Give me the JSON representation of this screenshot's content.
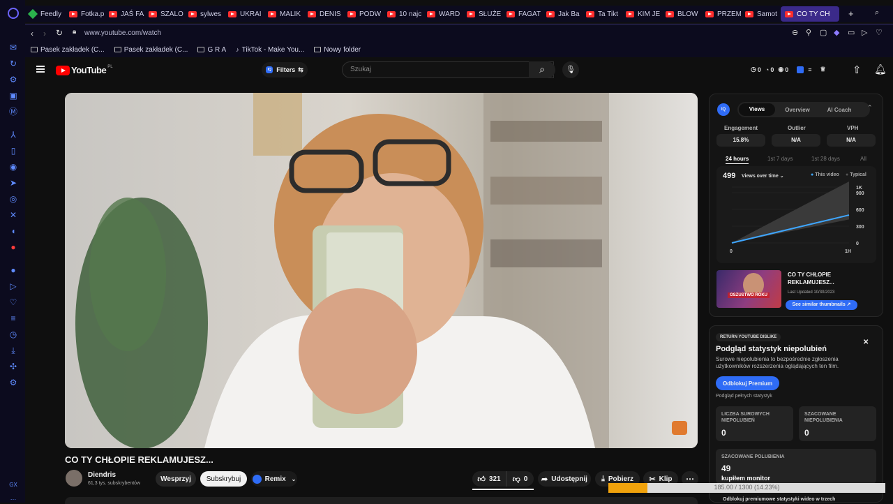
{
  "tabs": [
    {
      "label": "Feedly",
      "icon": "feedly-icon"
    },
    {
      "label": "Fotka.p",
      "icon": "youtube-icon"
    },
    {
      "label": "JAŚ FA",
      "icon": "youtube-icon"
    },
    {
      "label": "SZALO",
      "icon": "youtube-icon"
    },
    {
      "label": "sylwes",
      "icon": "youtube-icon"
    },
    {
      "label": "UKRAI",
      "icon": "youtube-icon"
    },
    {
      "label": "MALIK",
      "icon": "youtube-icon"
    },
    {
      "label": "DENIS",
      "icon": "youtube-icon"
    },
    {
      "label": "PODW",
      "icon": "youtube-icon"
    },
    {
      "label": "10 najc",
      "icon": "youtube-icon"
    },
    {
      "label": "WARD",
      "icon": "youtube-icon"
    },
    {
      "label": "SŁUŻE",
      "icon": "youtube-icon"
    },
    {
      "label": "FAGAT",
      "icon": "youtube-icon"
    },
    {
      "label": "Jak Ba",
      "icon": "youtube-icon"
    },
    {
      "label": "Ta Tikt",
      "icon": "youtube-icon"
    },
    {
      "label": "KIM JE",
      "icon": "youtube-icon"
    },
    {
      "label": "BLOW",
      "icon": "youtube-icon"
    },
    {
      "label": "PRZEM",
      "icon": "youtube-icon"
    },
    {
      "label": "Samot",
      "icon": "youtube-icon"
    },
    {
      "label": "CO TY CH",
      "icon": "youtube-icon",
      "active": true
    }
  ],
  "address": {
    "url": "www.youtube.com/watch"
  },
  "bookmarks": [
    "Pasek zakładek (C...",
    "Pasek zakładek (C...",
    "G R A",
    "TikTok - Make You...",
    "Nowy folder"
  ],
  "yt": {
    "logo": "YouTube",
    "region": "PL",
    "filters": "Filters",
    "search_placeholder": "Szukaj",
    "counters": [
      "0",
      "0",
      "0"
    ]
  },
  "video": {
    "title": "CO TY CHŁOPIE REKLAMUJESZ...",
    "channel": "Diendris",
    "subscribers": "61,3 tys. subskrybentów",
    "support_label": "Wesprzyj",
    "subscribe_label": "Subskrybuj",
    "remix_label": "Remix",
    "likes": "321",
    "dislikes": "0",
    "share_label": "Udostępnij",
    "download_label": "Pobierz",
    "clip_label": "Klip"
  },
  "vidiq": {
    "tabs": [
      "Views",
      "Overview",
      "AI Coach"
    ],
    "metrics": [
      {
        "label": "Engagement",
        "value": "15.8%"
      },
      {
        "label": "Outlier",
        "value": "N/A"
      },
      {
        "label": "VPH",
        "value": "N/A"
      }
    ],
    "ranges": [
      "24 hours",
      "1st 7 days",
      "1st 28 days",
      "All"
    ],
    "views": "499",
    "views_label": "Views over time",
    "legend_this": "This video",
    "legend_typical": "Typical",
    "thumb_title": "CO TY CHŁOPIE REKLAMUJESZ...",
    "thumb_updated": "Last Updated 10/30/2023",
    "thumb_button": "See similar thumbnails",
    "thumb_overlay": "OSZUSTWO ROKU",
    "colors": {
      "this_video": "#3ea6ff",
      "typical": "#3a3a3a"
    }
  },
  "chart_data": {
    "type": "area",
    "x": [
      "0",
      "1H"
    ],
    "ylabel": "",
    "yticks": [
      "0",
      "300",
      "600",
      "900",
      "1K"
    ],
    "ylim": [
      0,
      1200
    ],
    "series": [
      {
        "name": "This video",
        "values": [
          0,
          499
        ]
      },
      {
        "name": "Typical",
        "values": [
          0,
          1100
        ],
        "range_low": [
          0,
          420
        ]
      }
    ]
  },
  "dislike": {
    "badge": "RETURN YOUTUBE DISLIKE",
    "title": "Podgląd statystyk niepolubień",
    "desc": "Surowe niepolubienia to bezpośrednie zgłoszenia użytkowników rozszerzenia oglądających ten film.",
    "premium": "Odblokuj Premium",
    "full_stats": "Podgląd pełnych statystyk",
    "raw_label": "LICZBA SUROWYCH NIEPOLUBIEŃ",
    "raw_value": "0",
    "est_label": "SZACOWANE NIEPOLUBIENIA",
    "est_value": "0",
    "likes_label": "SZACOWANE POLUBIENIA",
    "likes_value": "49",
    "footer": "Odblokuj premiumowe statystyki wideo w trzech"
  },
  "overlay": {
    "tooltip": "kupiłem monitor",
    "progress_text": "185.00 / 1300 (14.23%)",
    "progress_fraction": 0.1423
  }
}
